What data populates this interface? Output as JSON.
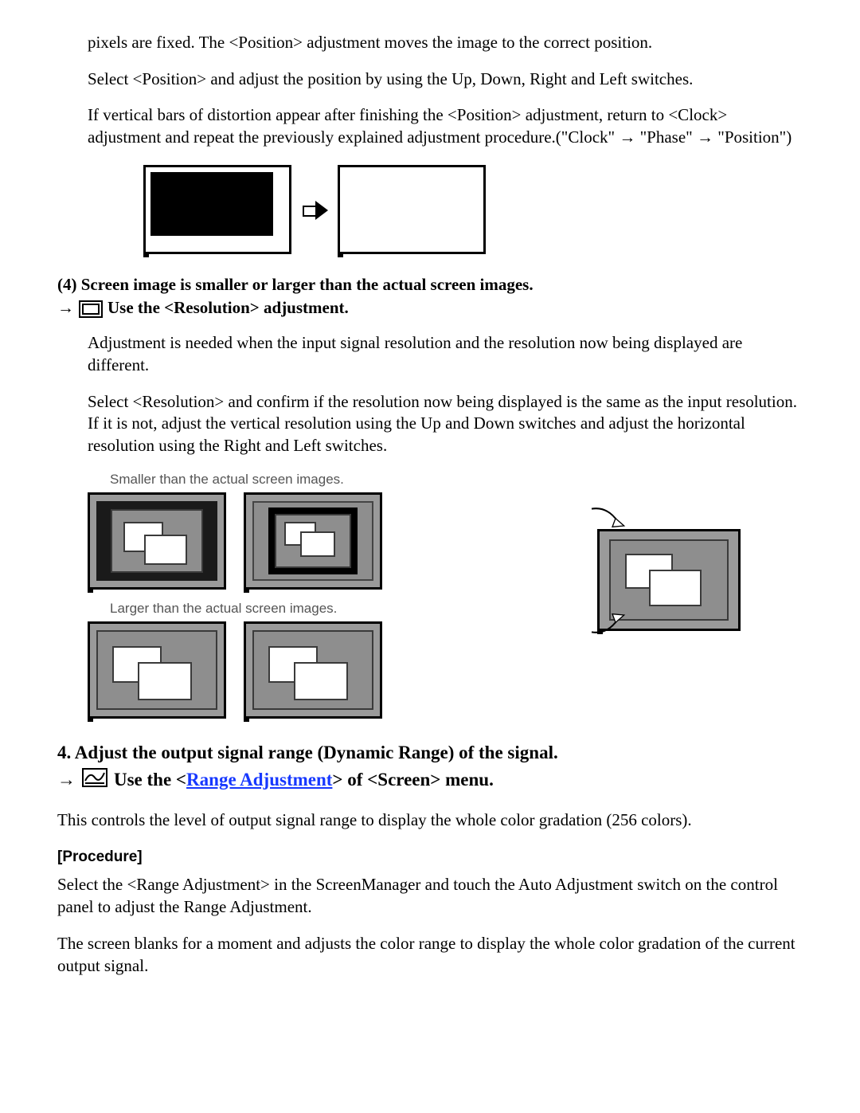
{
  "intro": {
    "p1": "pixels are fixed. The <Position> adjustment moves the image to the correct position.",
    "p2": "Select <Position> and adjust the position by using the Up, Down, Right and Left switches.",
    "p3": "If vertical bars of distortion appear after finishing the <Position> adjustment, return to <Clock> adjustment and repeat the previously explained adjustment procedure.(\"Clock\" → \"Phase\" → \"Position\")"
  },
  "section4": {
    "label": "(4) Screen image is smaller or larger than the actual screen images.",
    "arrow": "→",
    "instruction": " Use the <Resolution> adjustment.",
    "p1": "Adjustment is needed when the input signal resolution and the resolution now being displayed are different.",
    "p2": "Select <Resolution> and confirm if the resolution now being displayed is the same as the input resolution. If it is not, adjust the vertical resolution using the Up and Down switches and adjust the horizontal resolution using the Right and Left switches.",
    "caption_smaller": "Smaller than the actual screen images.",
    "caption_larger": "Larger than the actual screen images."
  },
  "step4": {
    "heading": "4. Adjust the output signal range (Dynamic Range) of the signal.",
    "arrow": "→",
    "use_prefix": " Use the <",
    "link_text": "Range Adjustment",
    "use_suffix": "> of <Screen> menu.",
    "desc": "This controls the level of output signal range to display the whole color gradation (256 colors).",
    "proc_label": "[Procedure]",
    "proc_p1": "Select the <Range Adjustment> in the ScreenManager and touch the Auto Adjustment switch on the control panel to adjust the Range Adjustment.",
    "proc_p2": "The screen blanks for a moment and adjusts the color range to display the whole color gradation of the current output signal."
  }
}
